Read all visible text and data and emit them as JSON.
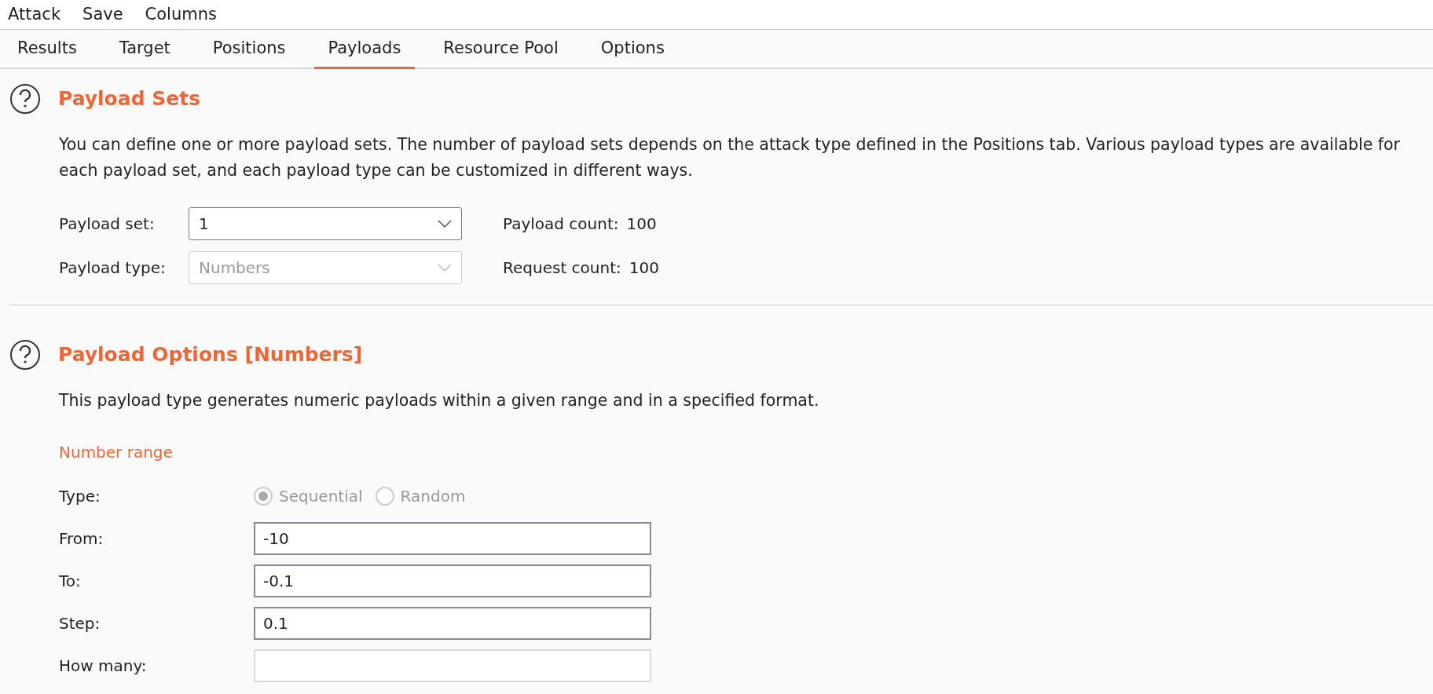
{
  "menu": [
    "Attack",
    "Save",
    "Columns"
  ],
  "tabs": [
    {
      "label": "Results",
      "selected": false
    },
    {
      "label": "Target",
      "selected": false
    },
    {
      "label": "Positions",
      "selected": false
    },
    {
      "label": "Payloads",
      "selected": true
    },
    {
      "label": "Resource Pool",
      "selected": false
    },
    {
      "label": "Options",
      "selected": false
    }
  ],
  "payload_sets": {
    "title": "Payload Sets",
    "description": "You can define one or more payload sets. The number of payload sets depends on the attack type defined in the Positions tab. Various payload types are available for each payload set, and each payload type can be customized in different ways.",
    "rows": [
      {
        "label": "Payload set:",
        "value": "1",
        "disabled": false,
        "count_label": "Payload count:",
        "count": "100"
      },
      {
        "label": "Payload type:",
        "value": "Numbers",
        "disabled": true,
        "count_label": "Request count:",
        "count": "100"
      }
    ]
  },
  "payload_options": {
    "title": "Payload Options [Numbers]",
    "description": "This payload type generates numeric payloads within a given range and in a specified format.",
    "subheading": "Number range",
    "fields": [
      {
        "kind": "radio",
        "label": "Type:",
        "disabled": true,
        "options": [
          {
            "label": "Sequential",
            "selected": true
          },
          {
            "label": "Random",
            "selected": false
          }
        ]
      },
      {
        "kind": "text",
        "label": "From:",
        "value": "-10",
        "disabled": false
      },
      {
        "kind": "text",
        "label": "To:",
        "value": "-0.1",
        "disabled": false
      },
      {
        "kind": "text",
        "label": "Step:",
        "value": "0.1",
        "disabled": false
      },
      {
        "kind": "text",
        "label": "How many:",
        "disabled": true
      }
    ]
  }
}
